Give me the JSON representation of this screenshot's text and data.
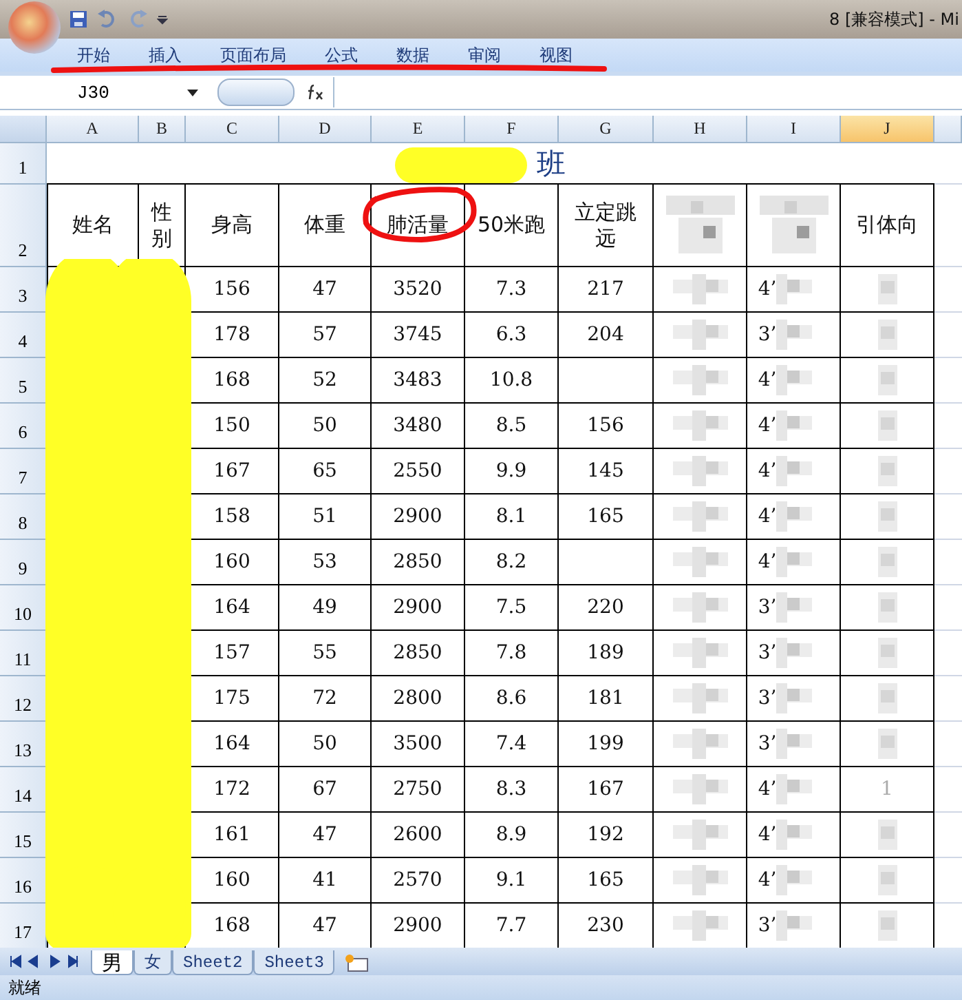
{
  "window": {
    "title": "8  [兼容模式] - Mi"
  },
  "ribbon_tabs": [
    {
      "label": "开始",
      "selected": false
    },
    {
      "label": "插入",
      "selected": false
    },
    {
      "label": "页面布局",
      "selected": false
    },
    {
      "label": "公式",
      "selected": false
    },
    {
      "label": "数据",
      "selected": false
    },
    {
      "label": "审阅",
      "selected": false
    },
    {
      "label": "视图",
      "selected": false
    }
  ],
  "name_box": "J30",
  "columns": [
    {
      "label": "A",
      "selected": false
    },
    {
      "label": "B",
      "selected": false
    },
    {
      "label": "C",
      "selected": false
    },
    {
      "label": "D",
      "selected": false
    },
    {
      "label": "E",
      "selected": false
    },
    {
      "label": "F",
      "selected": false
    },
    {
      "label": "G",
      "selected": false
    },
    {
      "label": "H",
      "selected": false
    },
    {
      "label": "I",
      "selected": false
    },
    {
      "label": "J",
      "selected": true
    }
  ],
  "title_row_number": "1",
  "title_cell": "班",
  "header_row_number": "2",
  "headers": [
    {
      "kind": "text",
      "text": "姓名"
    },
    {
      "kind": "text",
      "text": "性别"
    },
    {
      "kind": "text",
      "text": "身高"
    },
    {
      "kind": "text",
      "text": "体重"
    },
    {
      "kind": "text",
      "text": "肺活量"
    },
    {
      "kind": "text",
      "text": "50米跑"
    },
    {
      "kind": "text",
      "text": "立定跳远"
    },
    {
      "kind": "mosaic"
    },
    {
      "kind": "mosaic"
    },
    {
      "kind": "text",
      "text": "引体向"
    }
  ],
  "rows": [
    {
      "n": "3",
      "c": "156",
      "d": "47",
      "e": "3520",
      "f": "7.3",
      "g": "217",
      "i": "4’"
    },
    {
      "n": "4",
      "c": "178",
      "d": "57",
      "e": "3745",
      "f": "6.3",
      "g": "204",
      "i": "3’"
    },
    {
      "n": "5",
      "c": "168",
      "d": "52",
      "e": "3483",
      "f": "10.8",
      "i": "4’"
    },
    {
      "n": "6",
      "c": "150",
      "d": "50",
      "e": "3480",
      "f": "8.5",
      "g": "156",
      "i": "4’"
    },
    {
      "n": "7",
      "c": "167",
      "d": "65",
      "e": "2550",
      "f": "9.9",
      "g": "145",
      "i": "4’"
    },
    {
      "n": "8",
      "c": "158",
      "d": "51",
      "e": "2900",
      "f": "8.1",
      "g": "165",
      "i": "4’"
    },
    {
      "n": "9",
      "c": "160",
      "d": "53",
      "e": "2850",
      "f": "8.2",
      "i": "4’"
    },
    {
      "n": "10",
      "c": "164",
      "d": "49",
      "e": "2900",
      "f": "7.5",
      "g": "220",
      "i": "3’"
    },
    {
      "n": "11",
      "c": "157",
      "d": "55",
      "e": "2850",
      "f": "7.8",
      "g": "189",
      "i": "3’"
    },
    {
      "n": "12",
      "c": "175",
      "d": "72",
      "e": "2800",
      "f": "8.6",
      "g": "181",
      "i": "3’"
    },
    {
      "n": "13",
      "c": "164",
      "d": "50",
      "e": "3500",
      "f": "7.4",
      "g": "199",
      "i": "3’"
    },
    {
      "n": "14",
      "c": "172",
      "d": "67",
      "e": "2750",
      "f": "8.3",
      "g": "167",
      "i": "4’",
      "j": "1"
    },
    {
      "n": "15",
      "c": "161",
      "d": "47",
      "e": "2600",
      "f": "8.9",
      "g": "192",
      "i": "4’"
    },
    {
      "n": "16",
      "c": "160",
      "d": "41",
      "e": "2570",
      "f": "9.1",
      "g": "165",
      "i": "4’"
    },
    {
      "n": "17",
      "c": "168",
      "d": "47",
      "e": "2900",
      "f": "7.7",
      "g": "230",
      "i": "3’"
    }
  ],
  "sheet_tabs": [
    {
      "label": "男",
      "selected": true
    },
    {
      "label": "女",
      "selected": false
    },
    {
      "label": "Sheet2",
      "selected": false
    },
    {
      "label": "Sheet3",
      "selected": false
    }
  ],
  "status_bar": "就绪"
}
